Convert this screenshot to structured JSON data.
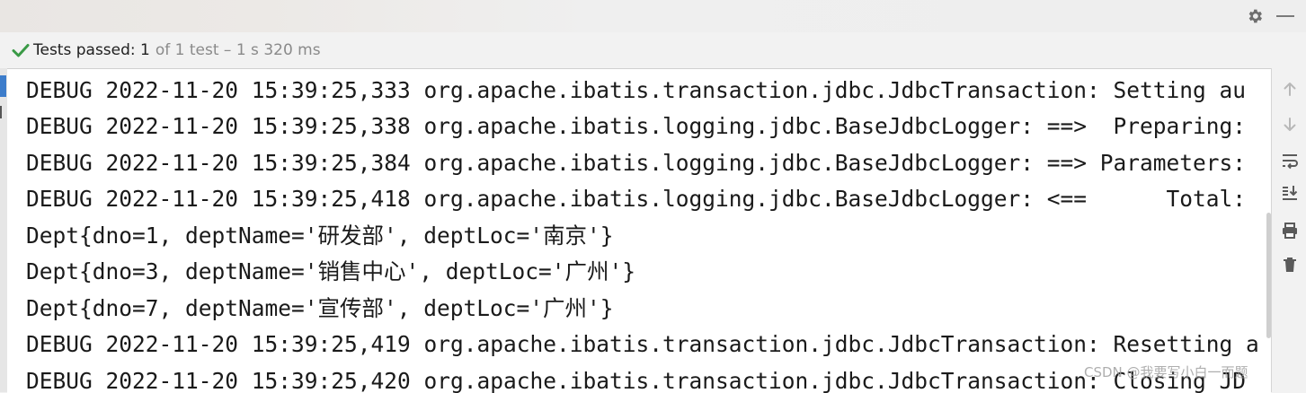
{
  "status": {
    "label": "Tests passed:",
    "count": "1",
    "detail": "of 1 test – 1 s 320 ms"
  },
  "icons": {
    "status": "check-icon",
    "settings": "gear-icon",
    "minimize": "minimize-icon",
    "toolbar": [
      "arrow-up-icon",
      "arrow-down-icon",
      "soft-wrap-icon",
      "scroll-to-end-icon",
      "print-icon",
      "trash-icon"
    ]
  },
  "colors": {
    "accent_green": "#3a9a46",
    "accent_blue": "#3d7dcb"
  },
  "console": {
    "lines": [
      "DEBUG 2022-11-20 15:39:25,333 org.apache.ibatis.transaction.jdbc.JdbcTransaction: Setting au",
      "DEBUG 2022-11-20 15:39:25,338 org.apache.ibatis.logging.jdbc.BaseJdbcLogger: ==>  Preparing:",
      "DEBUG 2022-11-20 15:39:25,384 org.apache.ibatis.logging.jdbc.BaseJdbcLogger: ==> Parameters:",
      "DEBUG 2022-11-20 15:39:25,418 org.apache.ibatis.logging.jdbc.BaseJdbcLogger: <==      Total:",
      "Dept{dno=1, deptName='研发部', deptLoc='南京'}",
      "Dept{dno=3, deptName='销售中心', deptLoc='广州'}",
      "Dept{dno=7, deptName='宣传部', deptLoc='广州'}",
      "DEBUG 2022-11-20 15:39:25,419 org.apache.ibatis.transaction.jdbc.JdbcTransaction: Resetting a",
      "DEBUG 2022-11-20 15:39:25,420 org.apache.ibatis.transaction.jdbc.JdbcTransaction: Closing JD"
    ]
  },
  "watermark": "CSDN @我要写小白一而题"
}
